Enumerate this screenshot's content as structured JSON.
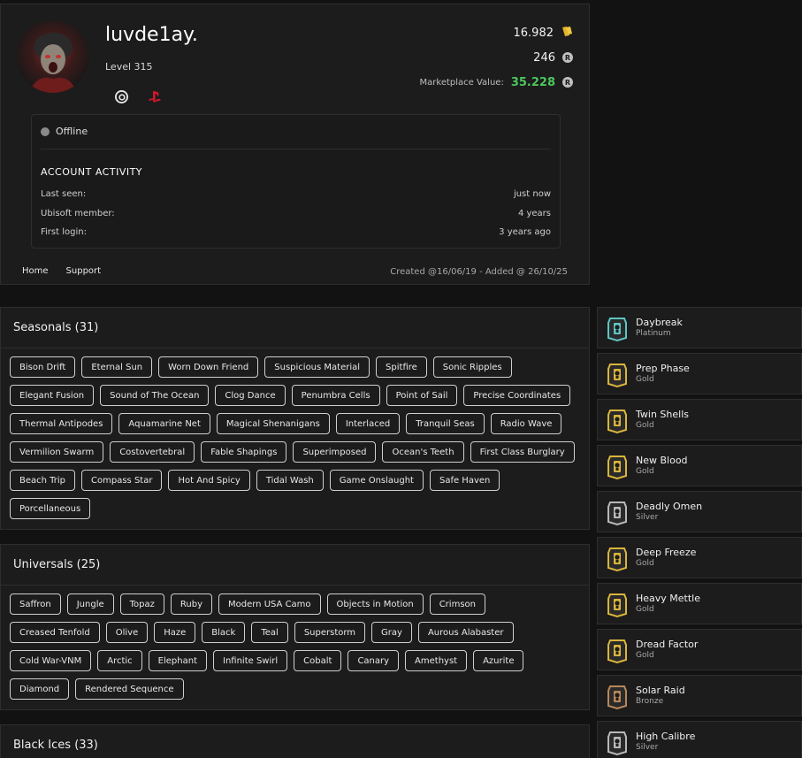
{
  "profile": {
    "username": "luvde1ay.",
    "level": "Level 315",
    "platforms": [
      "ubisoft-icon",
      "playstation-icon"
    ],
    "credits": "16.982",
    "renown": "246",
    "marketplace_label": "Marketplace Value:",
    "marketplace_value": "35.228",
    "status": "Offline",
    "activity_title": "ACCOUNT ACTIVITY",
    "activity": [
      {
        "label": "Last seen:",
        "value": "just now"
      },
      {
        "label": "Ubisoft member:",
        "value": "4 years"
      },
      {
        "label": "First login:",
        "value": "3 years ago"
      }
    ],
    "nav": [
      "Home",
      "Support"
    ],
    "created": "Created @16/06/19 - Added @ 26/10/25"
  },
  "sections": [
    {
      "title": "Seasonals (31)",
      "items": [
        "Bison Drift",
        "Eternal Sun",
        "Worn Down Friend",
        "Suspicious Material",
        "Spitfire",
        "Sonic Ripples",
        "Elegant Fusion",
        "Sound of The Ocean",
        "Clog Dance",
        "Penumbra Cells",
        "Point of Sail",
        "Precise Coordinates",
        "Thermal Antipodes",
        "Aquamarine Net",
        "Magical Shenanigans",
        "Interlaced",
        "Tranquil Seas",
        "Radio Wave",
        "Vermilion Swarm",
        "Costovertebral",
        "Fable Shapings",
        "Superimposed",
        "Ocean's Teeth",
        "First Class Burglary",
        "Beach Trip",
        "Compass Star",
        "Hot And Spicy",
        "Tidal Wash",
        "Game Onslaught",
        "Safe Haven",
        "Porcellaneous"
      ]
    },
    {
      "title": "Universals (25)",
      "items": [
        "Saffron",
        "Jungle",
        "Topaz",
        "Ruby",
        "Modern USA Camo",
        "Objects in Motion",
        "Crimson",
        "Creased Tenfold",
        "Olive",
        "Haze",
        "Black",
        "Teal",
        "Superstorm",
        "Gray",
        "Aurous Alabaster",
        "Cold War-VNM",
        "Arctic",
        "Elephant",
        "Infinite Swirl",
        "Cobalt",
        "Canary",
        "Amethyst",
        "Azurite",
        "Diamond",
        "Rendered Sequence"
      ]
    },
    {
      "title": "Black Ices (33)",
      "items": []
    }
  ],
  "ranks": [
    {
      "name": "Daybreak",
      "tier": "Platinum",
      "color": "#5fc4c4"
    },
    {
      "name": "Prep Phase",
      "tier": "Gold",
      "color": "#d9b53b"
    },
    {
      "name": "Twin Shells",
      "tier": "Gold",
      "color": "#d9b53b"
    },
    {
      "name": "New Blood",
      "tier": "Gold",
      "color": "#d9b53b"
    },
    {
      "name": "Deadly Omen",
      "tier": "Silver",
      "color": "#b8b8b8"
    },
    {
      "name": "Deep Freeze",
      "tier": "Gold",
      "color": "#d9b53b"
    },
    {
      "name": "Heavy Mettle",
      "tier": "Gold",
      "color": "#d9b53b"
    },
    {
      "name": "Dread Factor",
      "tier": "Gold",
      "color": "#d9b53b"
    },
    {
      "name": "Solar Raid",
      "tier": "Bronze",
      "color": "#b8875a"
    },
    {
      "name": "High Calibre",
      "tier": "Silver",
      "color": "#b8b8b8"
    }
  ]
}
